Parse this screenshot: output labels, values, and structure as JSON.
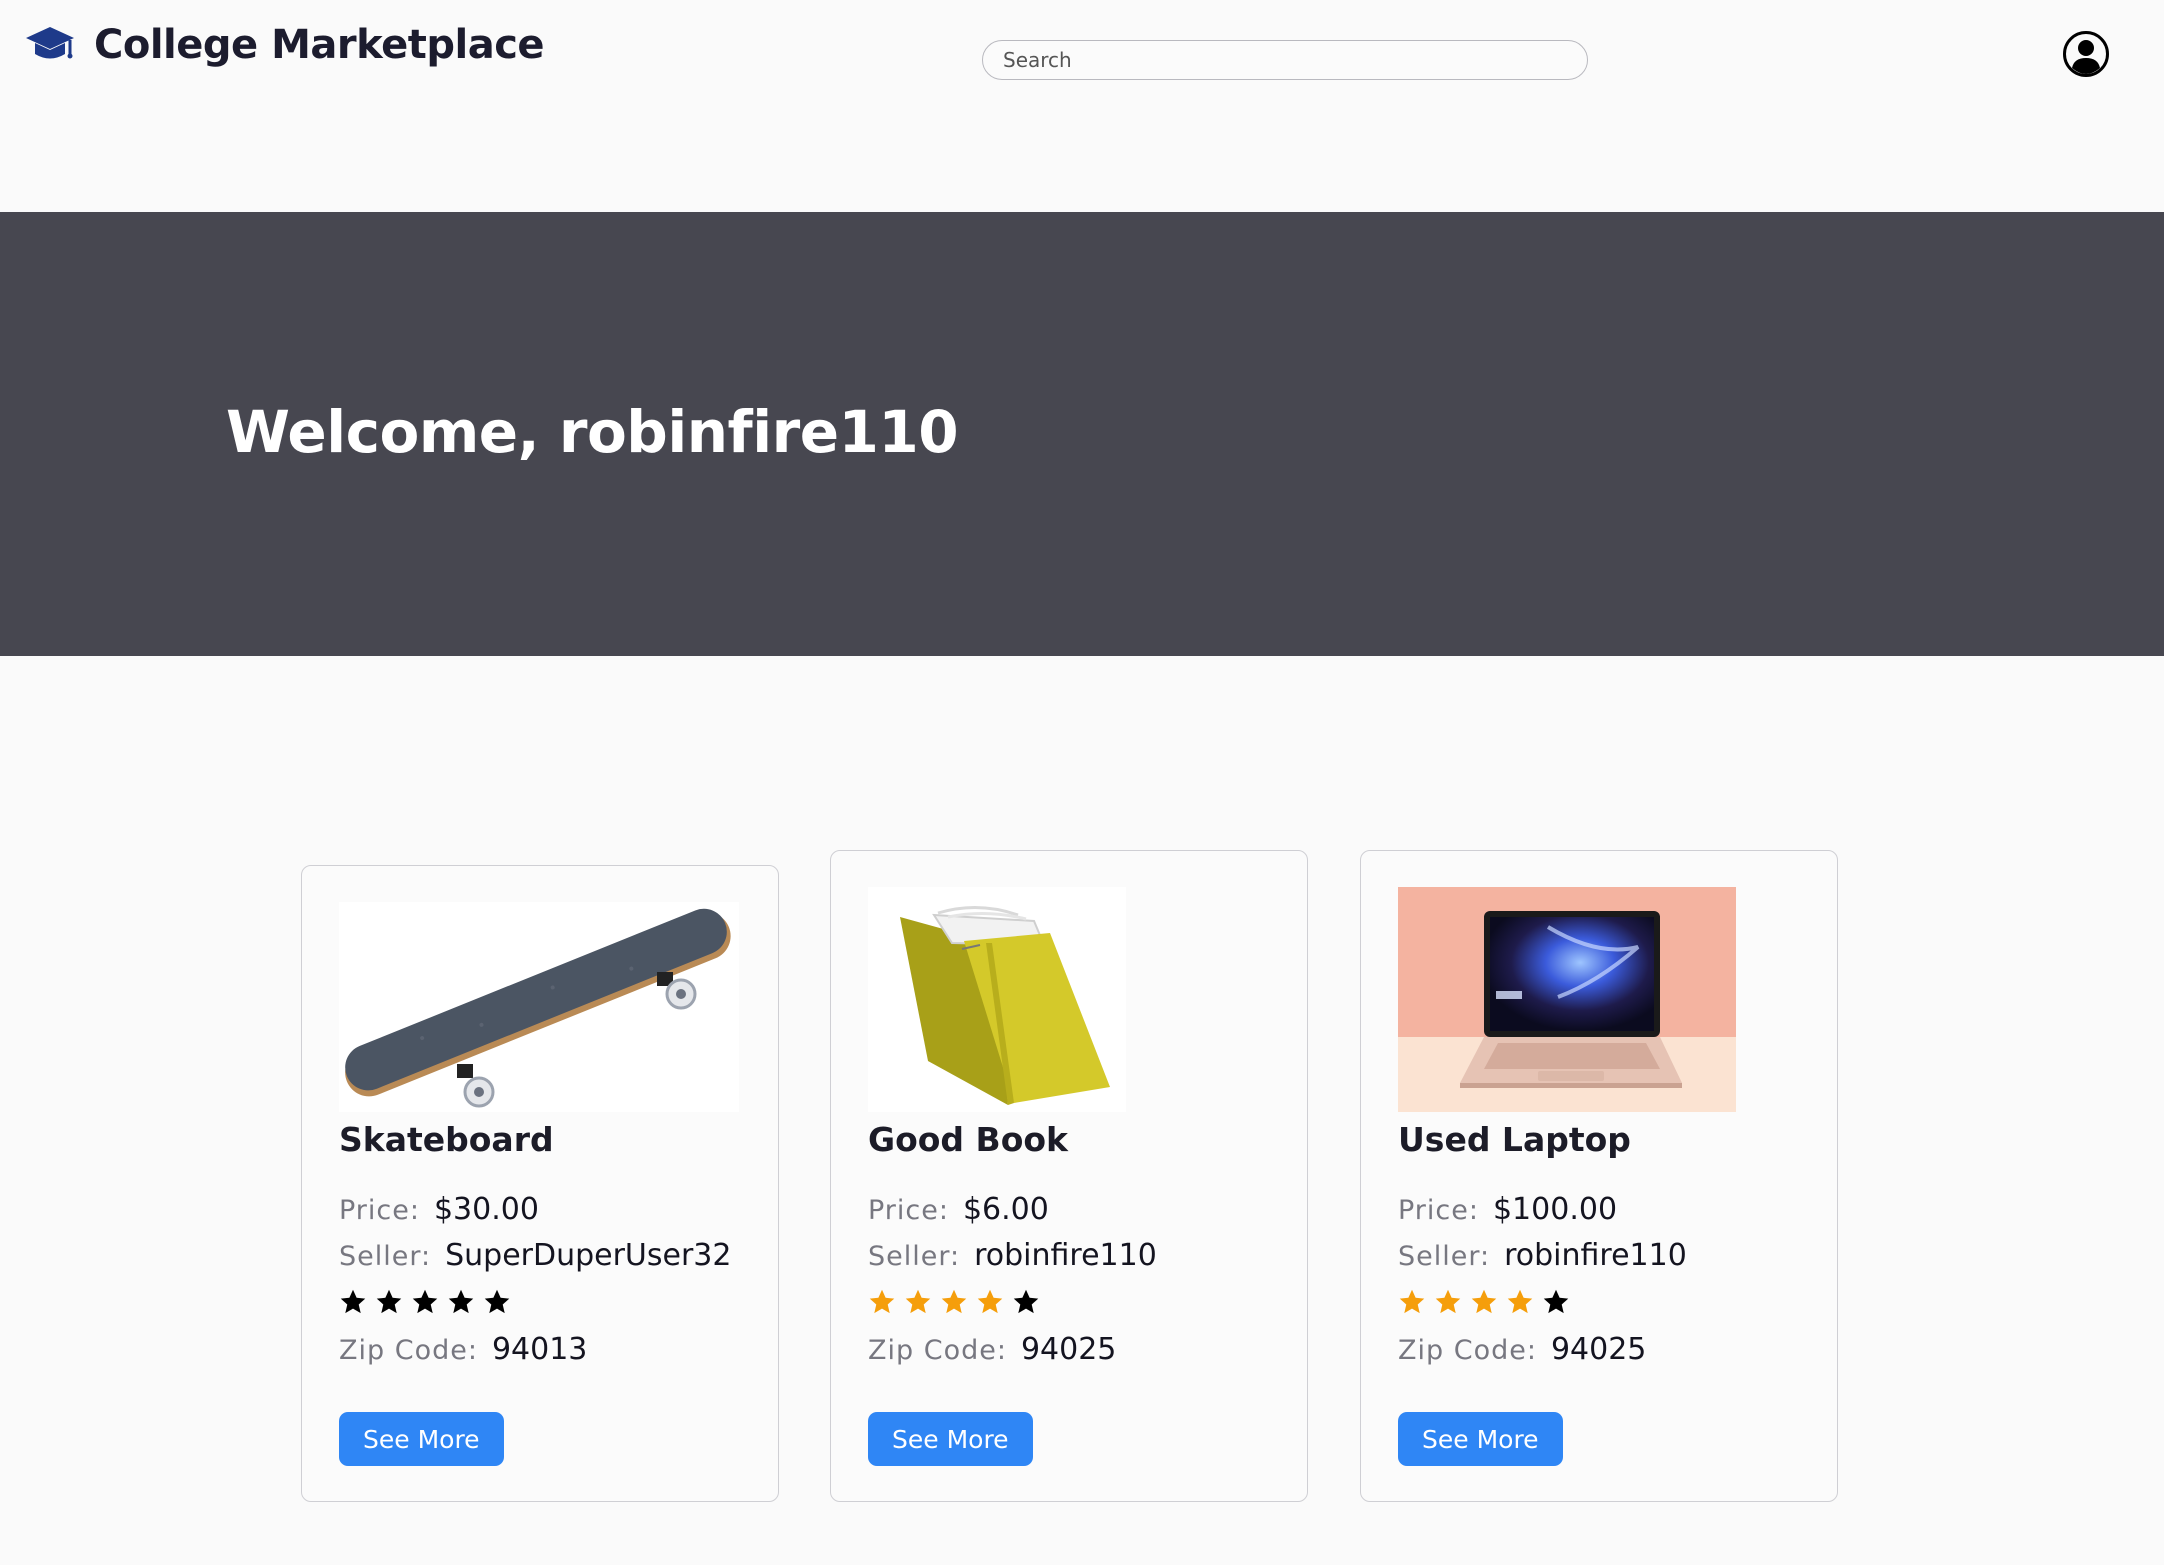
{
  "header": {
    "brand_title": "College Marketplace",
    "search_placeholder": "Search"
  },
  "hero": {
    "welcome_text": "Welcome, robinfire110"
  },
  "listing_labels": {
    "price": "Price:",
    "seller": "Seller:",
    "zip": "Zip Code:",
    "button": "See More"
  },
  "colors": {
    "hero_background": "#474750",
    "accent_button": "#2f86f5",
    "star_filled": "#f59e0b",
    "star_default": "#000000"
  },
  "listings": [
    {
      "title": "Skateboard",
      "price": "$30.00",
      "seller": "SuperDuperUser32",
      "rating": 0,
      "rating_max": 5,
      "zip": "94013",
      "image_icon": "skateboard-image"
    },
    {
      "title": "Good Book",
      "price": "$6.00",
      "seller": "robinfire110",
      "rating": 4,
      "rating_max": 5,
      "zip": "94025",
      "image_icon": "book-image"
    },
    {
      "title": "Used Laptop",
      "price": "$100.00",
      "seller": "robinfire110",
      "rating": 4,
      "rating_max": 5,
      "zip": "94025",
      "image_icon": "laptop-image"
    }
  ]
}
